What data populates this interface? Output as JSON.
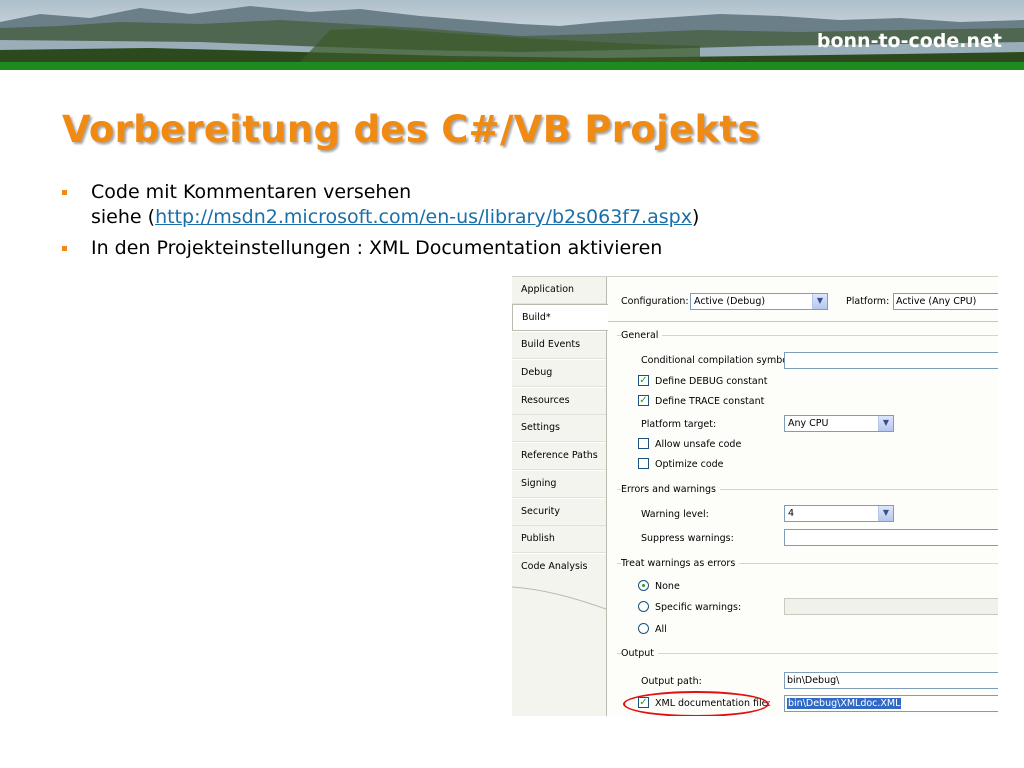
{
  "header": {
    "site": "bonn-to-code.net"
  },
  "slide": {
    "title": "Vorbereitung des C#/VB Projekts",
    "bullets": {
      "b1_line1": "Code mit Kommentaren versehen",
      "b1_prefix": "siehe (",
      "b1_link": "http://msdn2.microsoft.com/en-us/library/b2s063f7.aspx",
      "b1_suffix": ")",
      "b2": "In den Projekteinstellungen : XML Documentation aktivieren"
    }
  },
  "vs": {
    "tabs": [
      "Application",
      "Build*",
      "Build Events",
      "Debug",
      "Resources",
      "Settings",
      "Reference Paths",
      "Signing",
      "Security",
      "Publish",
      "Code Analysis"
    ],
    "active_tab": "Build*",
    "configuration_label": "Configuration:",
    "configuration_value": "Active (Debug)",
    "platform_label": "Platform:",
    "platform_value": "Active (Any CPU)",
    "general": {
      "header": "General",
      "conditional_label": "Conditional compilation symbols:",
      "conditional_value": "",
      "define_debug": "Define DEBUG constant",
      "define_trace": "Define TRACE constant",
      "platform_target_label": "Platform target:",
      "platform_target_value": "Any CPU",
      "allow_unsafe": "Allow unsafe code",
      "optimize": "Optimize code"
    },
    "errors": {
      "header": "Errors and warnings",
      "warning_level_label": "Warning level:",
      "warning_level_value": "4",
      "suppress_label": "Suppress warnings:",
      "suppress_value": ""
    },
    "treat": {
      "header": "Treat warnings as errors",
      "none": "None",
      "specific": "Specific warnings:",
      "all": "All"
    },
    "output": {
      "header": "Output",
      "path_label": "Output path:",
      "path_value": "bin\\Debug\\",
      "xml_label": "XML documentation file:",
      "xml_value": "bin\\Debug\\XMLdoc.XML"
    }
  },
  "colors": {
    "title": "#f08a12",
    "stripe": "#1f8a1f",
    "link": "#1a6fa8",
    "highlight": "#e01010"
  }
}
